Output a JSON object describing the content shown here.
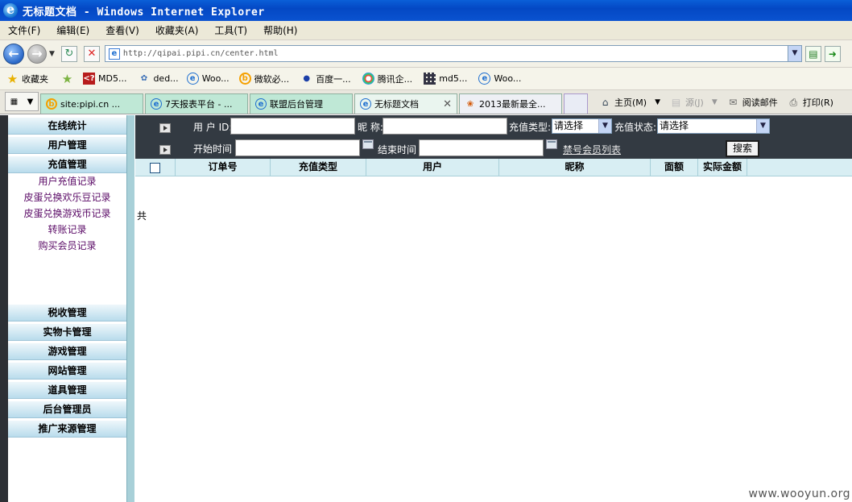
{
  "window": {
    "title": "无标题文档 - Windows Internet Explorer"
  },
  "menubar": {
    "items": [
      "文件(F)",
      "编辑(E)",
      "查看(V)",
      "收藏夹(A)",
      "工具(T)",
      "帮助(H)"
    ]
  },
  "address": {
    "url": "http://qipai.pipi.cn/center.html"
  },
  "favorites": {
    "label": "收藏夹",
    "items": [
      "MD5...",
      "ded...",
      "Woo...",
      "微软必...",
      "百度一...",
      "腾讯企...",
      "md5...",
      "Woo..."
    ]
  },
  "tabs": {
    "items": [
      {
        "label": "site:pipi.cn ..."
      },
      {
        "label": "7天报表平台 - ..."
      },
      {
        "label": "联盟后台管理"
      },
      {
        "label": "无标题文档"
      },
      {
        "label": "2013最新最全..."
      }
    ],
    "active_index": 3
  },
  "commands": {
    "home": "主页(M)",
    "feeds": "源(J)",
    "read_mail": "阅读邮件",
    "print": "打印(R)"
  },
  "sidebar": {
    "top_sections": [
      "在线统计",
      "用户管理",
      "充值管理"
    ],
    "sub_items": [
      "用户充值记录",
      "皮蛋兑换欢乐豆记录",
      "皮蛋兑换游戏币记录",
      "转账记录",
      "购买会员记录"
    ],
    "bottom_sections": [
      "税收管理",
      "实物卡管理",
      "游戏管理",
      "网站管理",
      "道具管理",
      "后台管理员",
      "推广来源管理"
    ]
  },
  "filter": {
    "user_id_label": "用 户 ID:",
    "nickname_label": "昵 称:",
    "recharge_type_label": "充值类型:",
    "recharge_type_value": "请选择",
    "recharge_status_label": "充值状态:",
    "recharge_status_value": "请选择",
    "start_time_label": "开始时间",
    "end_time_label": "结束时间",
    "banned_list_link": "禁号会员列表",
    "search_button": "搜索"
  },
  "table": {
    "columns": [
      "订单号",
      "充值类型",
      "用户",
      "昵称",
      "面额",
      "实际金额"
    ]
  },
  "footer": {
    "total_label": "共"
  },
  "watermark": "www.wooyun.org"
}
